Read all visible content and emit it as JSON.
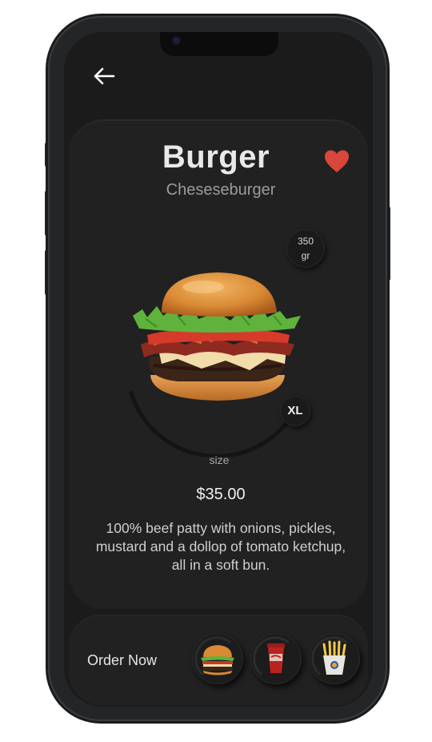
{
  "nav": {
    "back_icon": "arrow-left-icon"
  },
  "product": {
    "title": "Burger",
    "subtitle": "Cheseseburger",
    "favorite_icon": "heart-icon",
    "favorite_color": "#d9463a",
    "weight_value": "350",
    "weight_unit": "gr",
    "selected_size": "XL",
    "size_label": "size",
    "price": "$35.00",
    "description": "100% beef patty with onions, pickles, mustard and a dollop of tomato ketchup, all in a soft bun."
  },
  "footer": {
    "order_label": "Order Now",
    "items": [
      {
        "icon": "burger-icon"
      },
      {
        "icon": "cola-cup-icon"
      },
      {
        "icon": "fries-icon"
      }
    ]
  }
}
